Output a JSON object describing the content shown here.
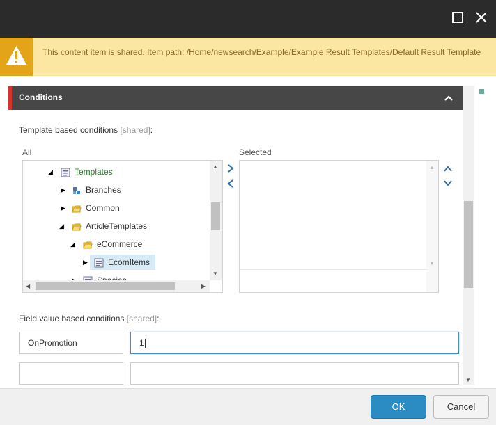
{
  "warning": {
    "text": "This content item is shared. Item path: /Home/newsearch/Example/Example Result Templates/Default Result Template"
  },
  "section": {
    "title": "Conditions"
  },
  "template_conditions": {
    "label": "Template based conditions",
    "shared_tag": "[shared]",
    "colon": ":",
    "all_label": "All",
    "selected_label": "Selected",
    "tree": [
      {
        "label": "Templates",
        "icon": "template-icon",
        "expanded": true
      },
      {
        "label": "Branches",
        "icon": "branch-icon",
        "expanded": false
      },
      {
        "label": "Common",
        "icon": "folder-icon",
        "expanded": false
      },
      {
        "label": "ArticleTemplates",
        "icon": "folder-icon",
        "expanded": true
      },
      {
        "label": "eCommerce",
        "icon": "folder-icon",
        "expanded": true
      },
      {
        "label": "EcomItems",
        "icon": "template-icon",
        "expanded": false,
        "selected": true
      },
      {
        "label": "Species",
        "icon": "template-icon",
        "expanded": false
      }
    ],
    "selected_items": []
  },
  "field_conditions": {
    "label": "Field value based conditions",
    "shared_tag": "[shared]",
    "colon": ":",
    "rows": [
      {
        "field": "OnPromotion",
        "value": "1"
      },
      {
        "field": "",
        "value": ""
      }
    ]
  },
  "footer": {
    "ok_label": "OK",
    "cancel_label": "Cancel"
  },
  "colors": {
    "titlebar": "#2b2b2b",
    "warning_bg": "#fbe6a2",
    "warning_icon_bg": "#e4a418",
    "section_bg": "#474747",
    "section_accent": "#d9322c",
    "tree_green": "#2c7a2c",
    "ok_blue": "#2b8bc3"
  }
}
